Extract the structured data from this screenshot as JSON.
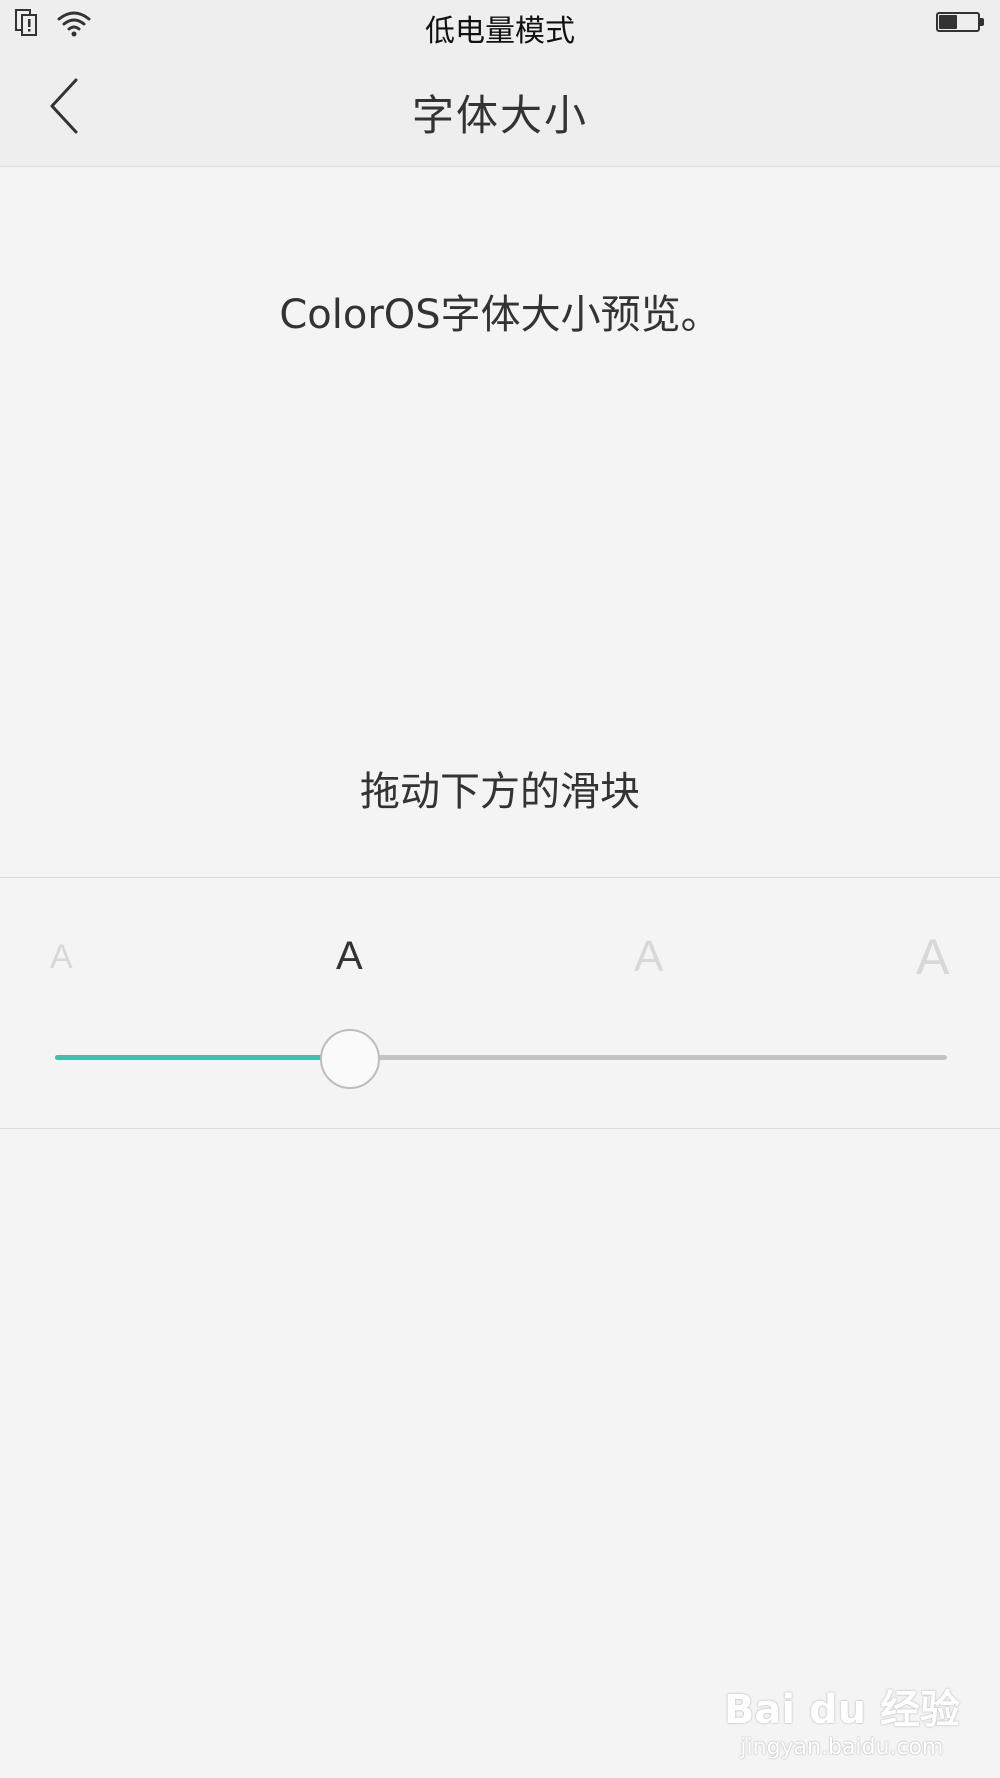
{
  "status_bar": {
    "title": "低电量模式",
    "icons": [
      "sim-icon",
      "wifi-icon",
      "battery-icon"
    ],
    "battery_level": 0.5
  },
  "nav": {
    "title": "字体大小",
    "back_icon": "chevron-left-icon"
  },
  "preview": {
    "text": "ColorOS字体大小预览。"
  },
  "hint": {
    "text": "拖动下方的滑块"
  },
  "font_size_slider": {
    "labels": [
      "A",
      "A",
      "A",
      "A"
    ],
    "selected_index": 1,
    "value_fraction": 0.33,
    "track_color": "#c3c3c3",
    "active_color": "#36c3b3",
    "active_label_color": "#333333",
    "inactive_label_color": "#d8d8d8"
  },
  "watermark": {
    "logo": "Bai du 经验",
    "url": "jingyan.baidu.com"
  }
}
